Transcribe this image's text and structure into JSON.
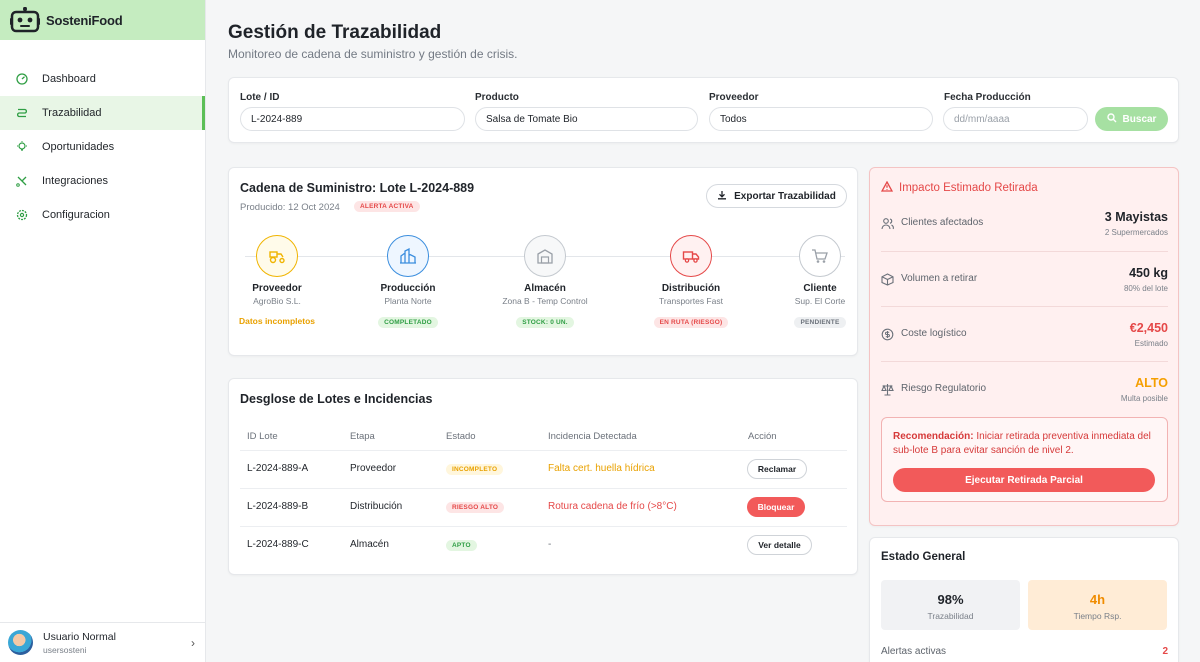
{
  "app": {
    "brand": "SosteniFood"
  },
  "sidebar": {
    "items": [
      {
        "label": "Dashboard",
        "icon": "gauge-icon"
      },
      {
        "label": "Trazabilidad",
        "icon": "route-icon",
        "active": true
      },
      {
        "label": "Oportunidades",
        "icon": "lightbulb-icon"
      },
      {
        "label": "Integraciones",
        "icon": "integration-icon"
      },
      {
        "label": "Configuracion",
        "icon": "gear-icon"
      }
    ],
    "user": {
      "name": "Usuario Normal",
      "handle": "usersosteni"
    }
  },
  "header": {
    "title": "Gestión de Trazabilidad",
    "subtitle": "Monitoreo de cadena de suministro y gestión de crisis."
  },
  "filters": {
    "lote_label": "Lote / ID",
    "lote_value": "L-2024-889",
    "producto_label": "Producto",
    "producto_value": "Salsa de Tomate Bio",
    "proveedor_label": "Proveedor",
    "proveedor_value": "Todos",
    "fecha_label": "Fecha Producción",
    "fecha_placeholder": "dd/mm/aaaa",
    "search_label": "Buscar"
  },
  "chain": {
    "title": "Cadena de Suministro: Lote L-2024-889",
    "produced": "Producido: 12 Oct 2024",
    "alert_badge": "ALERTA ACTIVA",
    "export_label": "Exportar Trazabilidad",
    "steps": [
      {
        "name": "Proveedor",
        "sub": "AgroBio S.L.",
        "status": "Datos incompletos",
        "color": "#f0b400"
      },
      {
        "name": "Producción",
        "sub": "Planta Norte",
        "status": "COMPLETADO",
        "color": "#3b8ede"
      },
      {
        "name": "Almacén",
        "sub": "Zona B - Temp Control",
        "status": "STOCK: 0 UN.",
        "color": "#b9bec5"
      },
      {
        "name": "Distribución",
        "sub": "Transportes Fast",
        "status": "EN RUTA (RIESGO)",
        "color": "#e54848"
      },
      {
        "name": "Cliente",
        "sub": "Sup. El Corte",
        "status": "PENDIENTE",
        "color": "#b9bec5"
      }
    ]
  },
  "lots": {
    "title": "Desglose de Lotes e Incidencias",
    "headers": [
      "ID Lote",
      "Etapa",
      "Estado",
      "Incidencia Detectada",
      "Acción"
    ],
    "rows": [
      {
        "id": "L-2024-889-A",
        "etapa": "Proveedor",
        "estado": "INCOMPLETO",
        "incidencia": "Falta cert. huella hídrica",
        "accion": "Reclamar"
      },
      {
        "id": "L-2024-889-B",
        "etapa": "Distribución",
        "estado": "RIESGO ALTO",
        "incidencia": "Rotura cadena de frío (>8°C)",
        "accion": "Bloquear"
      },
      {
        "id": "L-2024-889-C",
        "etapa": "Almacén",
        "estado": "APTO",
        "incidencia": "-",
        "accion": "Ver detalle"
      }
    ]
  },
  "impact": {
    "title": "Impacto Estimado Retirada",
    "rows": [
      {
        "label": "Clientes afectados",
        "value": "3 Mayistas",
        "sub": "2 Supermercados",
        "icon": "users-icon"
      },
      {
        "label": "Volumen a retirar",
        "value": "450 kg",
        "sub": "80% del lote",
        "icon": "box-icon"
      },
      {
        "label": "Coste logístico",
        "value": "€2,450",
        "sub": "Estimado",
        "icon": "coin-icon"
      },
      {
        "label": "Riesgo Regulatorio",
        "value": "ALTO",
        "sub": "Multa posible",
        "icon": "scale-icon"
      }
    ],
    "reco_prefix": "Recomendación:",
    "reco_text": " Iniciar retirada preventiva inmediata del sub-lote B para evitar sanción de nivel 2.",
    "reco_button": "Ejecutar Retirada Parcial"
  },
  "general": {
    "title": "Estado General",
    "trace_value": "98%",
    "trace_label": "Trazabilidad",
    "resp_value": "4h",
    "resp_label": "Tiempo Rsp.",
    "alerts_label": "Alertas activas",
    "alerts_count": "2"
  }
}
